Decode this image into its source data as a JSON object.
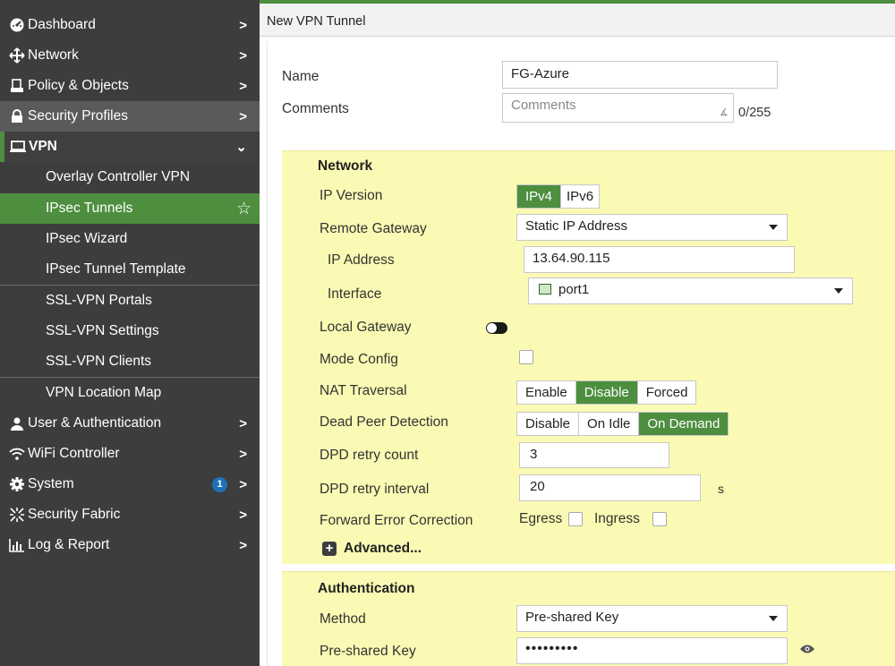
{
  "sidebar": {
    "items": [
      {
        "label": "Dashboard",
        "icon": "dashboard-icon"
      },
      {
        "label": "Network",
        "icon": "network-icon"
      },
      {
        "label": "Policy & Objects",
        "icon": "policy-icon"
      },
      {
        "label": "Security Profiles",
        "icon": "lock-icon"
      },
      {
        "label": "VPN",
        "icon": "monitor-icon"
      },
      {
        "label": "Overlay Controller VPN"
      },
      {
        "label": "IPsec Tunnels"
      },
      {
        "label": "IPsec Wizard"
      },
      {
        "label": "IPsec Tunnel Template"
      },
      {
        "label": "SSL-VPN Portals"
      },
      {
        "label": "SSL-VPN Settings"
      },
      {
        "label": "SSL-VPN Clients"
      },
      {
        "label": "VPN Location Map"
      },
      {
        "label": "User & Authentication",
        "icon": "user-icon"
      },
      {
        "label": "WiFi Controller",
        "icon": "wifi-icon"
      },
      {
        "label": "System",
        "icon": "gear-icon",
        "badge": "1"
      },
      {
        "label": "Security Fabric",
        "icon": "fabric-icon"
      },
      {
        "label": "Log & Report",
        "icon": "chart-icon"
      }
    ]
  },
  "header": {
    "title": "New VPN Tunnel"
  },
  "form": {
    "name_label": "Name",
    "name_value": "FG-Azure",
    "comments_label": "Comments",
    "comments_placeholder": "Comments",
    "comments_count": "0/255"
  },
  "network": {
    "title": "Network",
    "ip_version_label": "IP Version",
    "ip_version_options": [
      "IPv4",
      "IPv6"
    ],
    "remote_gateway_label": "Remote Gateway",
    "remote_gateway_value": "Static IP Address",
    "ip_address_label": "IP Address",
    "ip_address_value": "13.64.90.115",
    "interface_label": "Interface",
    "interface_value": "port1",
    "local_gateway_label": "Local Gateway",
    "mode_config_label": "Mode Config",
    "nat_traversal_label": "NAT Traversal",
    "nat_traversal_options": [
      "Enable",
      "Disable",
      "Forced"
    ],
    "dpd_label": "Dead Peer Detection",
    "dpd_options": [
      "Disable",
      "On Idle",
      "On Demand"
    ],
    "dpd_retry_count_label": "DPD retry count",
    "dpd_retry_count_value": "3",
    "dpd_retry_interval_label": "DPD retry interval",
    "dpd_retry_interval_value": "20",
    "dpd_retry_interval_unit": "s",
    "fec_label": "Forward Error Correction",
    "fec_egress_label": "Egress",
    "fec_ingress_label": "Ingress",
    "advanced_label": "Advanced..."
  },
  "authentication": {
    "title": "Authentication",
    "method_label": "Method",
    "method_value": "Pre-shared Key",
    "psk_label": "Pre-shared Key",
    "psk_value": "•••••••••"
  },
  "colors": {
    "accent": "#4d8f3f",
    "sidebar_bg": "#3d3d3d",
    "panel_bg": "#fafab4",
    "badge": "#1d71b8"
  }
}
